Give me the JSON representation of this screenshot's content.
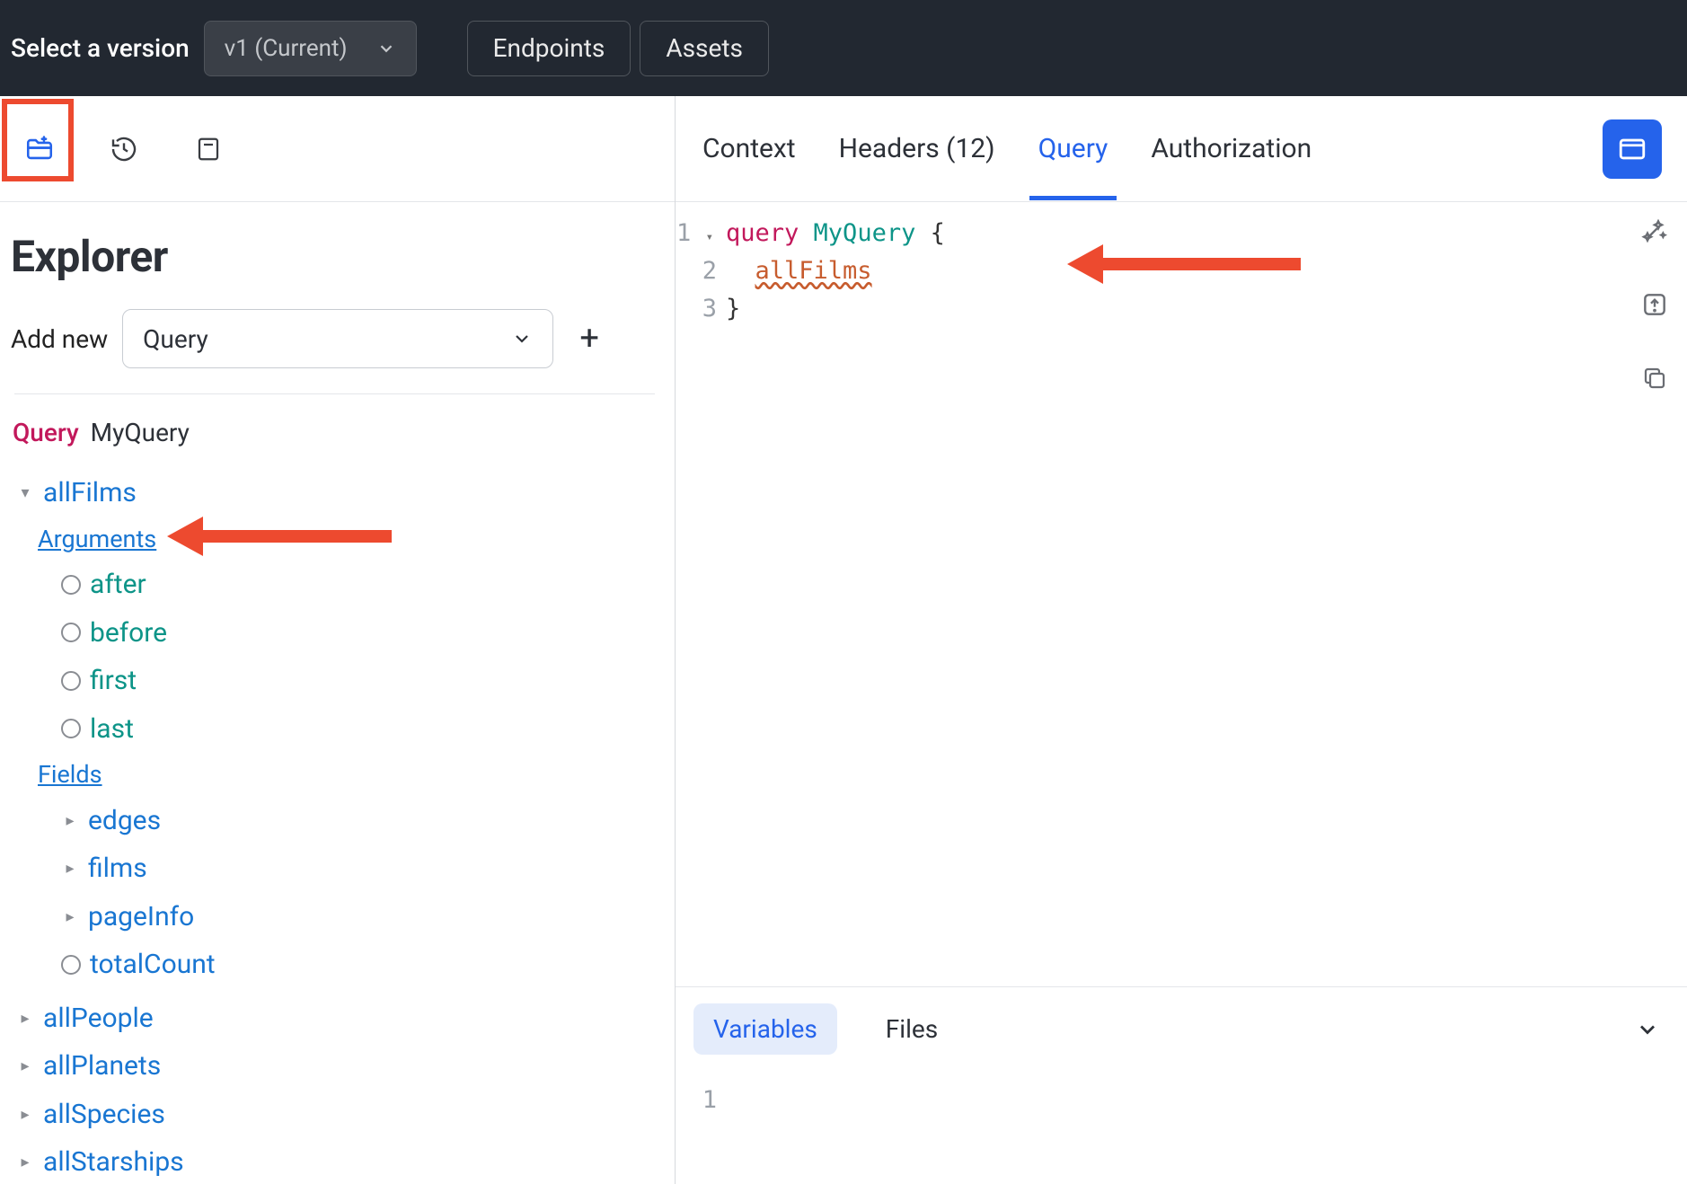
{
  "topbar": {
    "version_label": "Select a version",
    "version_value": "v1 (Current)",
    "endpoints": "Endpoints",
    "assets": "Assets"
  },
  "left_toolbar": {
    "explorer_active": true
  },
  "explorer": {
    "title": "Explorer",
    "addnew_label": "Add new",
    "addnew_value": "Query",
    "breadcrumb_type": "Query",
    "breadcrumb_name": "MyQuery",
    "tree": {
      "allFilms": {
        "label": "allFilms",
        "arguments_label": "Arguments",
        "args": [
          "after",
          "before",
          "first",
          "last"
        ],
        "fields_label": "Fields",
        "fields_expandable": [
          "edges",
          "films",
          "pageInfo"
        ],
        "fields_leaf": [
          "totalCount"
        ]
      },
      "rest": [
        "allPeople",
        "allPlanets",
        "allSpecies",
        "allStarships"
      ]
    }
  },
  "right_tabs": {
    "context": "Context",
    "headers": "Headers (12)",
    "query": "Query",
    "authorization": "Authorization"
  },
  "editor": {
    "lines": [
      {
        "n": "1",
        "tokens": [
          {
            "t": "query ",
            "c": "kw"
          },
          {
            "t": "MyQuery ",
            "c": "typename"
          },
          {
            "t": "{",
            "c": "brace"
          }
        ]
      },
      {
        "n": "2",
        "tokens": [
          {
            "t": "  ",
            "c": ""
          },
          {
            "t": "allFilms",
            "c": "field-err"
          }
        ]
      },
      {
        "n": "3",
        "tokens": [
          {
            "t": "}",
            "c": "brace"
          }
        ]
      }
    ]
  },
  "bottom": {
    "variables": "Variables",
    "files": "Files",
    "line1": "1"
  }
}
